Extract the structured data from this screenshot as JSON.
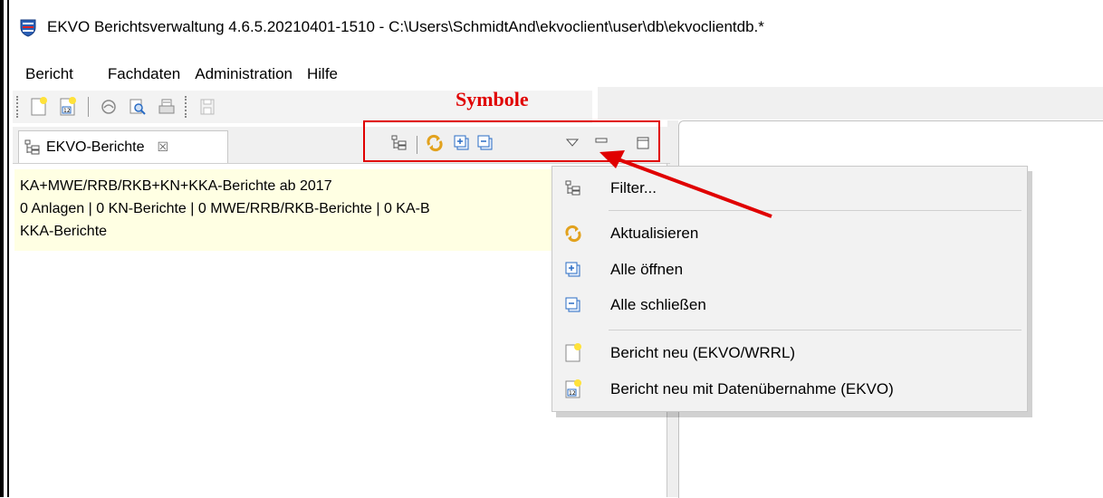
{
  "window": {
    "title": "EKVO Berichtsverwaltung 4.6.5.20210401-1510 - C:\\Users\\SchmidtAnd\\ekvoclient\\user\\db\\ekvoclientdb.*"
  },
  "menubar": {
    "items": [
      "Bericht",
      "Fachdaten",
      "Administration",
      "Hilfe"
    ]
  },
  "toolbar": {
    "icons": [
      "new-report-icon",
      "new-report-import-icon",
      "open-icon",
      "preview-icon",
      "print-icon",
      "save-icon"
    ]
  },
  "annotation": {
    "label": "Symbole",
    "color": "#e00000"
  },
  "view": {
    "tab_label": "EKVO-Berichte",
    "tab_close": "☒",
    "toolbar_icons": [
      "filter-icon",
      "refresh-icon",
      "expand-all-icon",
      "collapse-all-icon",
      "view-menu-icon",
      "minimize-icon",
      "maximize-icon"
    ]
  },
  "content": {
    "line1": "KA+MWE/RRB/RKB+KN+KKA-Berichte ab 2017",
    "line2": "0 Anlagen | 0 KN-Berichte | 0 MWE/RRB/RKB-Berichte | 0 KA-B",
    "line3": "KKA-Berichte"
  },
  "context_menu": {
    "items": [
      {
        "label": "Filter...",
        "icon": "filter-icon"
      },
      {
        "label": "Aktualisieren",
        "icon": "refresh-icon"
      },
      {
        "label": "Alle öffnen",
        "icon": "expand-all-icon"
      },
      {
        "label": "Alle schließen",
        "icon": "collapse-all-icon"
      },
      {
        "label": "Bericht neu (EKVO/WRRL)",
        "icon": "new-report-icon"
      },
      {
        "label": "Bericht neu mit Datenübernahme (EKVO)",
        "icon": "new-report-import-icon"
      }
    ]
  },
  "colors": {
    "highlight_yellow": "#ffffe3",
    "annotation_red": "#e00000",
    "icon_blue": "#2a6cc4"
  }
}
